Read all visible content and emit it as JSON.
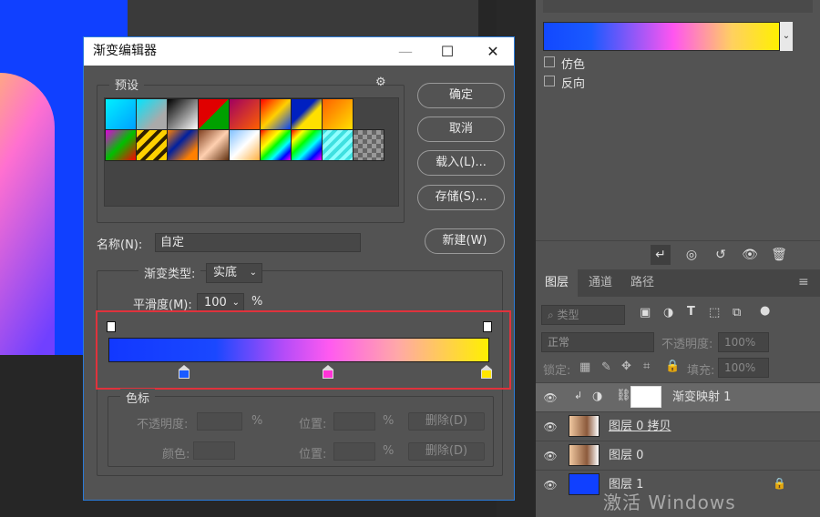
{
  "colors": {
    "accent": "#2b7bd8",
    "highlight": "#e0323c",
    "stop_left": "#1a5aff",
    "stop_mid": "#ff33d6",
    "stop_right": "#ffe600",
    "layer_fill": "#1040ff"
  },
  "dialog": {
    "title": "渐变编辑器",
    "presets_label": "预设",
    "buttons": {
      "ok": "确定",
      "cancel": "取消",
      "load": "载入(L)...",
      "save": "存储(S)...",
      "new": "新建(W)"
    },
    "name_label": "名称(N):",
    "name_value": "自定",
    "gradient_type_label": "渐变类型:",
    "gradient_type_value": "实底",
    "smoothness_label": "平滑度(M):",
    "smoothness_value": "100",
    "percent": "%",
    "stops_label": "色标",
    "opacity_label": "不透明度:",
    "color_label": "颜色:",
    "location_label": "位置:",
    "delete_label": "删除(D)"
  },
  "properties": {
    "dither_label": "仿色",
    "reverse_label": "反向"
  },
  "layers_panel": {
    "tabs": [
      "图层",
      "通道",
      "路径"
    ],
    "filter_kind": "类型",
    "blend_mode": "正常",
    "opacity_label": "不透明度:",
    "opacity_value": "100%",
    "lock_label": "锁定:",
    "fill_label": "填充:",
    "fill_value": "100%",
    "layers": [
      "渐变映射 1",
      "图层 0 拷贝",
      "图层 0",
      "图层 1"
    ]
  },
  "watermark": "激活 Windows"
}
